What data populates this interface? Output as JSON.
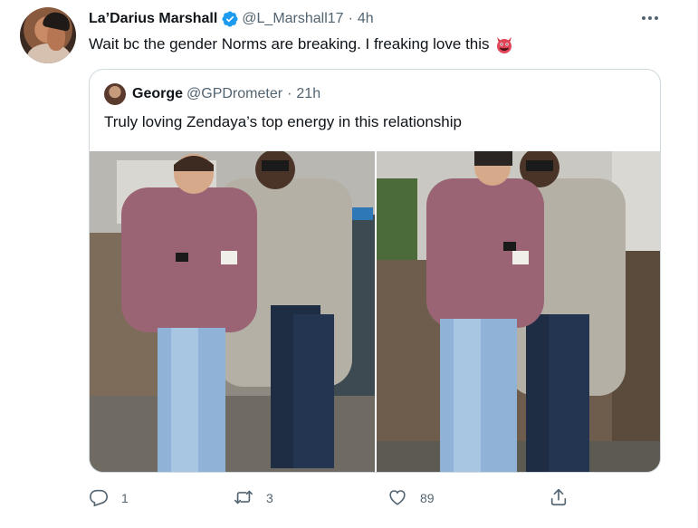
{
  "tweet": {
    "author_name": "La’Darius Marshall",
    "author_handle": "@L_Marshall17",
    "separator": "·",
    "time": "4h",
    "text": "Wait bc the gender Norms are breaking. I freaking love this",
    "emoji_icon": "devil-face-emoji",
    "verified_icon": "verified-badge-icon",
    "accent_color": "#1d9bf0"
  },
  "quote": {
    "author_name": "George",
    "author_handle": "@GPDrometer",
    "separator": "·",
    "time": "21h",
    "text": "Truly loving Zendaya’s top energy in this relationship",
    "photos": [
      "couple-walking-photo-1",
      "couple-walking-photo-2"
    ]
  },
  "actions": {
    "reply_count": "1",
    "retweet_count": "3",
    "like_count": "89",
    "share_label": ""
  }
}
